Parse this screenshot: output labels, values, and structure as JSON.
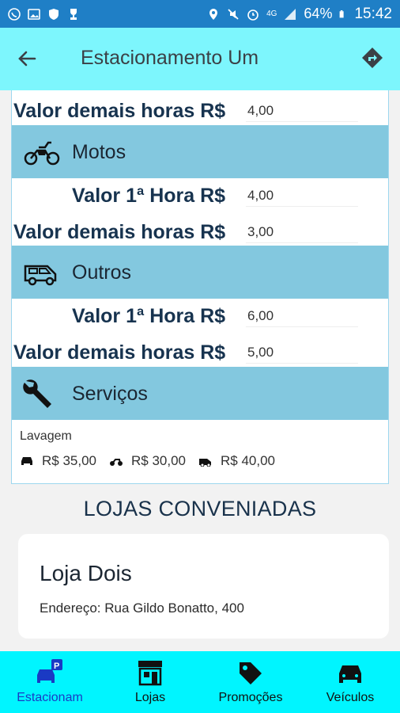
{
  "status_bar": {
    "battery": "64%",
    "time": "15:42",
    "network": "4G"
  },
  "app_bar": {
    "title": "Estacionamento Um"
  },
  "prices": [
    {
      "label": "Valor demais horas R$",
      "value": "4,00"
    },
    {
      "label": "Valor 1ª Hora R$",
      "value": "4,00"
    },
    {
      "label": "Valor demais horas R$",
      "value": "3,00"
    },
    {
      "label": "Valor 1ª Hora R$",
      "value": "6,00"
    },
    {
      "label": "Valor demais horas R$",
      "value": "5,00"
    }
  ],
  "sections": {
    "motos": {
      "label": "Motos",
      "icon": "motorcycle-icon"
    },
    "outros": {
      "label": "Outros",
      "icon": "van-icon"
    },
    "servicos": {
      "label": "Serviços",
      "icon": "wrench-icon"
    }
  },
  "services": {
    "title": "Lavagem",
    "prices": [
      "R$ 35,00",
      "R$ 30,00",
      "R$ 40,00"
    ]
  },
  "lojas": {
    "heading": "LOJAS CONVENIADAS",
    "store": {
      "name": "Loja Dois",
      "address": "Endereço: Rua Gildo Bonatto, 400"
    }
  },
  "bottom_nav": [
    {
      "label": "Estacionam",
      "icon": "parking-car-icon",
      "active": true
    },
    {
      "label": "Lojas",
      "icon": "store-icon",
      "active": false
    },
    {
      "label": "Promoções",
      "icon": "tag-icon",
      "active": false
    },
    {
      "label": "Veículos",
      "icon": "car-icon",
      "active": false
    }
  ],
  "colors": {
    "status_bar": "#1f7fc6",
    "app_bar": "#7df6fd",
    "section": "#83c8df",
    "bottom_nav": "#00f5ff",
    "active_nav": "#1a3ac4"
  }
}
